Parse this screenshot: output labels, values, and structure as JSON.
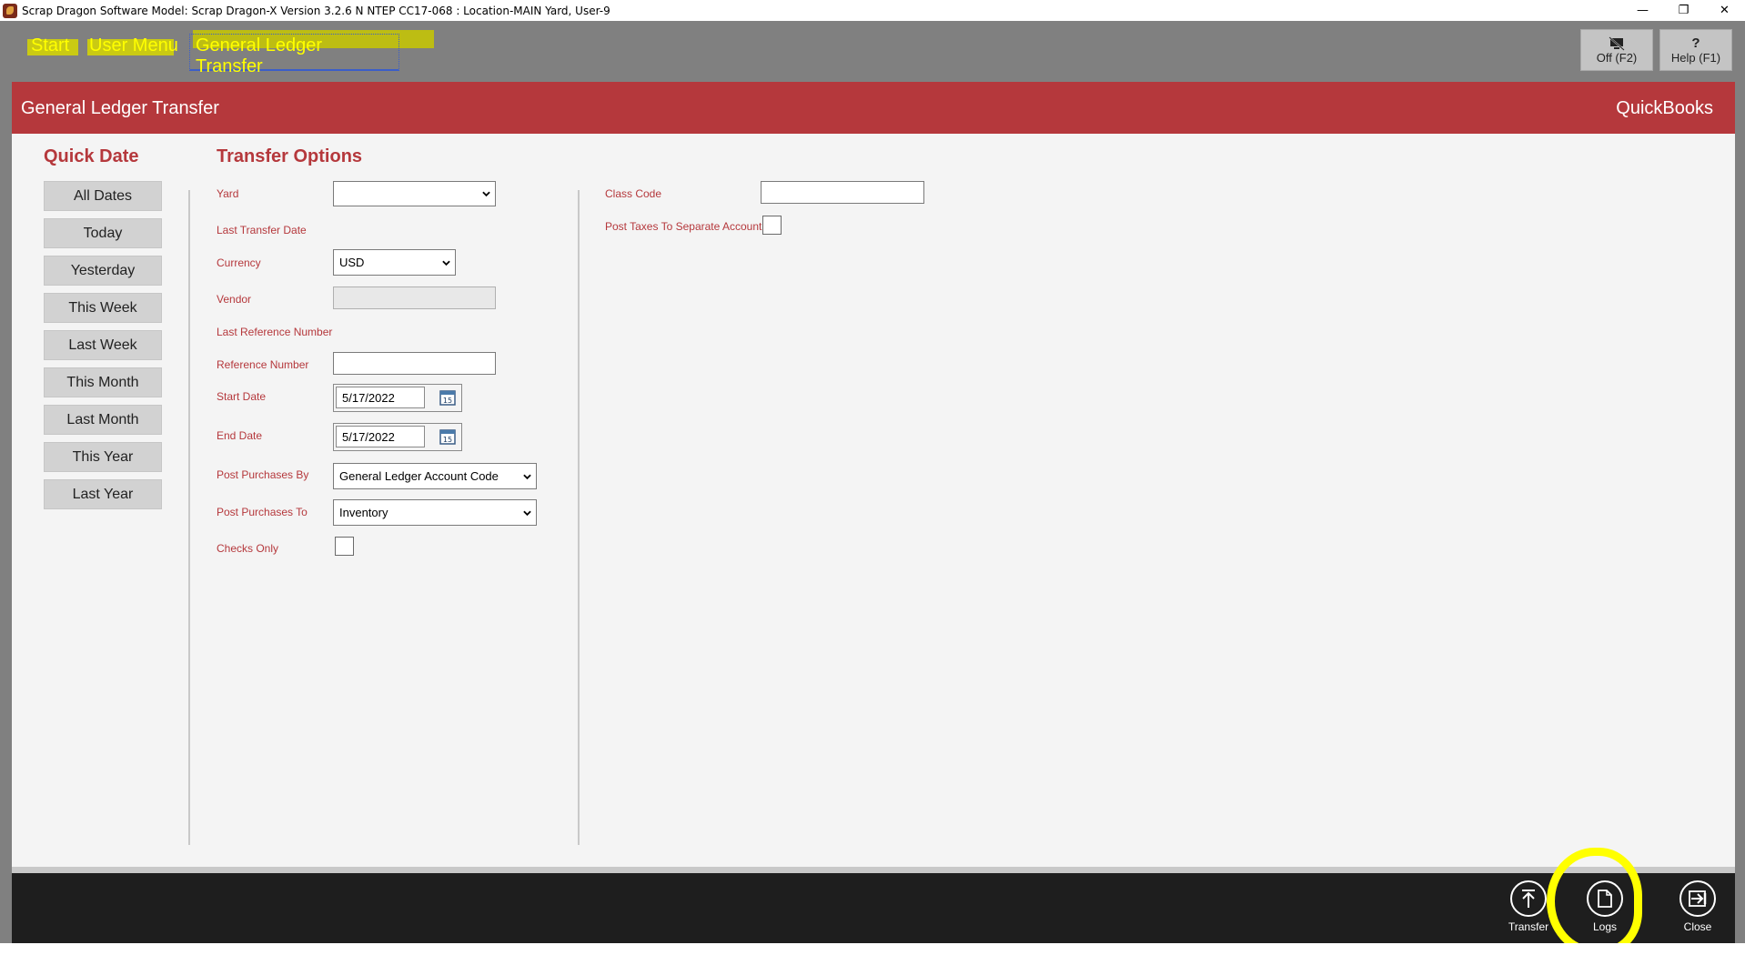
{
  "window": {
    "title": "Scrap Dragon Software Model: Scrap Dragon-X Version 3.2.6 N NTEP CC17-068 : Location-MAIN Yard, User-9",
    "controls": {
      "minimize": "—",
      "restore": "❐",
      "close": "✕"
    }
  },
  "breadcrumb": {
    "start": "Start",
    "user_menu": "User Menu",
    "current": "General Ledger Transfer"
  },
  "top_buttons": {
    "off": {
      "icon": "monitor-off-icon",
      "label": "Off (F2)"
    },
    "help": {
      "icon": "question-icon",
      "glyph": "?",
      "label": "Help (F1)"
    }
  },
  "header": {
    "title": "General Ledger Transfer",
    "right": "QuickBooks"
  },
  "quick_date": {
    "title": "Quick Date",
    "buttons": [
      "All Dates",
      "Today",
      "Yesterday",
      "This Week",
      "Last Week",
      "This Month",
      "Last Month",
      "This Year",
      "Last Year"
    ]
  },
  "transfer_options": {
    "title": "Transfer Options",
    "yard": {
      "label": "Yard",
      "value": ""
    },
    "last_transfer_date": {
      "label": "Last Transfer Date"
    },
    "currency": {
      "label": "Currency",
      "value": "USD"
    },
    "vendor": {
      "label": "Vendor",
      "value": ""
    },
    "last_reference_number": {
      "label": "Last Reference Number"
    },
    "reference_number": {
      "label": "Reference Number",
      "value": ""
    },
    "start_date": {
      "label": "Start Date",
      "value": "5/17/2022"
    },
    "end_date": {
      "label": "End Date",
      "value": "5/17/2022"
    },
    "post_purchases_by": {
      "label": "Post Purchases By",
      "value": "General Ledger Account Code"
    },
    "post_purchases_to": {
      "label": "Post Purchases To",
      "value": "Inventory"
    },
    "checks_only": {
      "label": "Checks Only",
      "checked": false
    }
  },
  "right_options": {
    "class_code": {
      "label": "Class Code",
      "value": ""
    },
    "post_taxes": {
      "label": "Post Taxes To Separate Account",
      "checked": false
    }
  },
  "footer_buttons": {
    "transfer": {
      "icon": "upload-arrow-icon",
      "label": "Transfer"
    },
    "logs": {
      "icon": "document-icon",
      "label": "Logs"
    },
    "close": {
      "icon": "exit-icon",
      "label": "Close"
    }
  },
  "colors": {
    "accent_red": "#b5383c",
    "nav_gray": "#808080",
    "highlight_yellow": "#ffff00",
    "footer_dark": "#1e1e1e"
  }
}
